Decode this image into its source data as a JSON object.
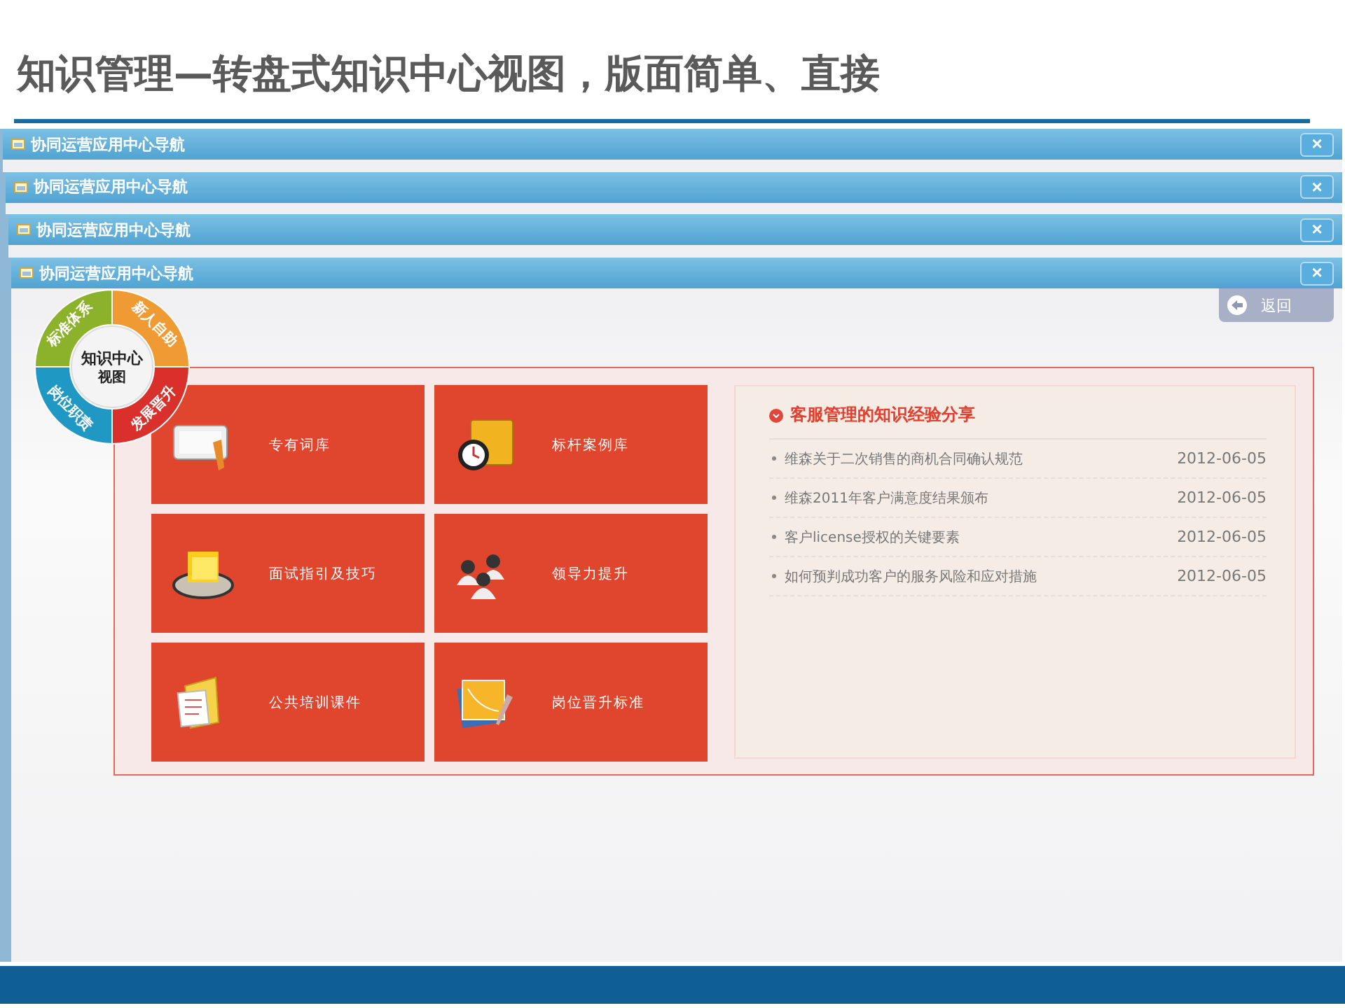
{
  "slide_title": "知识管理—转盘式知识中心视图，版面简单、直接",
  "windows": [
    {
      "title": "协同运营应用中心导航",
      "close_label": "×"
    },
    {
      "title": "协同运营应用中心导航",
      "close_label": "×"
    },
    {
      "title": "协同运营应用中心导航",
      "close_label": "×"
    },
    {
      "title": "协同运营应用中心导航",
      "close_label": "×"
    }
  ],
  "back_button": "返回",
  "wheel": {
    "center_lines": [
      "知识中心",
      "视图"
    ],
    "segments": [
      {
        "label": "标准体系",
        "color": "#8cb12b"
      },
      {
        "label": "新人自助",
        "color": "#ef9a32"
      },
      {
        "label": "发展晋升",
        "color": "#d9302b"
      },
      {
        "label": "岗位职责",
        "color": "#1f98c4"
      }
    ]
  },
  "tiles": [
    {
      "label": "专有词库",
      "kind": "notepad"
    },
    {
      "label": "标杆案例库",
      "kind": "clockbook"
    },
    {
      "label": "面试指引及技巧",
      "kind": "tray"
    },
    {
      "label": "领导力提升",
      "kind": "people"
    },
    {
      "label": "公共培训课件",
      "kind": "folder"
    },
    {
      "label": "岗位晋升标准",
      "kind": "chart"
    }
  ],
  "news": {
    "title": "客服管理的知识经验分享",
    "items": [
      {
        "text": "维森关于二次销售的商机合同确认规范",
        "date": "2012-06-05"
      },
      {
        "text": "维森2011年客户满意度结果颁布",
        "date": "2012-06-05"
      },
      {
        "text": "客户license授权的关键要素",
        "date": "2012-06-05"
      },
      {
        "text": "如何预判成功客户的服务风险和应对措施",
        "date": "2012-06-05"
      }
    ]
  }
}
